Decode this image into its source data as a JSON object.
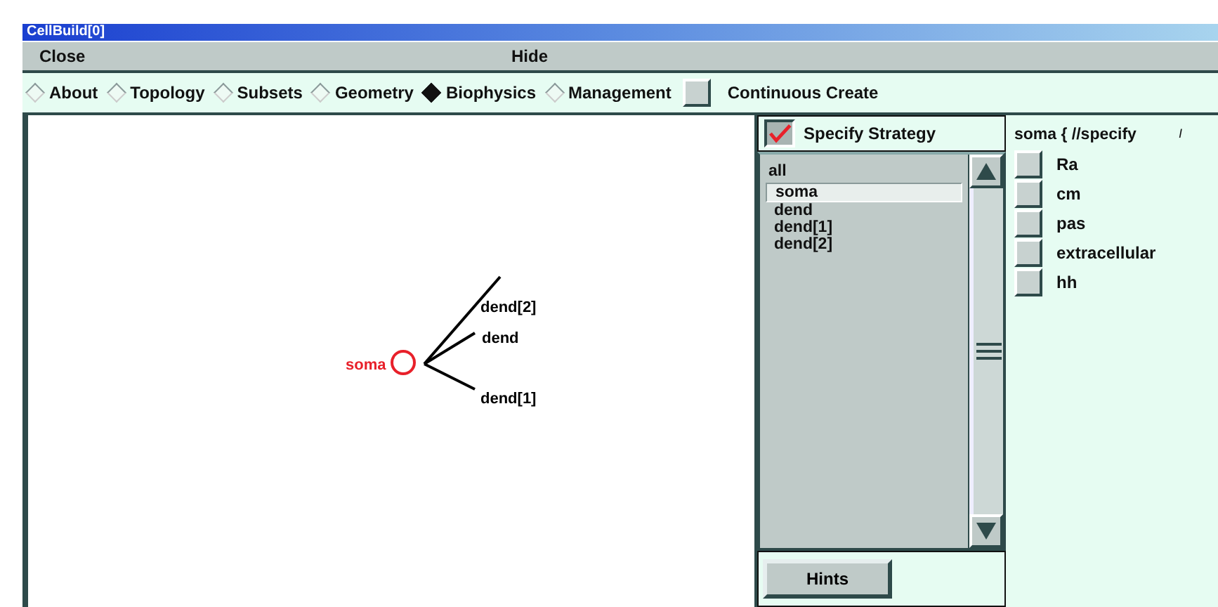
{
  "window": {
    "title": "CellBuild[0]"
  },
  "menu": [
    "Close",
    "Hide"
  ],
  "tabs": [
    {
      "label": "About",
      "selected": false
    },
    {
      "label": "Topology",
      "selected": false
    },
    {
      "label": "Subsets",
      "selected": false
    },
    {
      "label": "Geometry",
      "selected": false
    },
    {
      "label": "Biophysics",
      "selected": true
    },
    {
      "label": "Management",
      "selected": false
    }
  ],
  "continuous_create": {
    "label": "Continuous Create",
    "checked": false
  },
  "canvas": {
    "labels": [
      {
        "text": "dend[2]",
        "color": "#000000"
      },
      {
        "text": "dend",
        "color": "#000000"
      },
      {
        "text": "dend[1]",
        "color": "#000000"
      },
      {
        "text": "soma",
        "color": "#e8202a"
      }
    ]
  },
  "strategy": {
    "label": "Specify Strategy",
    "checked": true
  },
  "subsets": [
    {
      "label": "all",
      "selected": false
    },
    {
      "label": "soma",
      "selected": true
    },
    {
      "label": "dend",
      "selected": false
    },
    {
      "label": "dend[1]",
      "selected": false
    },
    {
      "label": "dend[2]",
      "selected": false
    }
  ],
  "hints_button": "Hints",
  "specify": {
    "header": "soma { //specify",
    "mark": "I",
    "mechanisms": [
      {
        "label": "Ra",
        "checked": false
      },
      {
        "label": "cm",
        "checked": false
      },
      {
        "label": "pas",
        "checked": false
      },
      {
        "label": "extracellular",
        "checked": false
      },
      {
        "label": "hh",
        "checked": false
      }
    ]
  }
}
